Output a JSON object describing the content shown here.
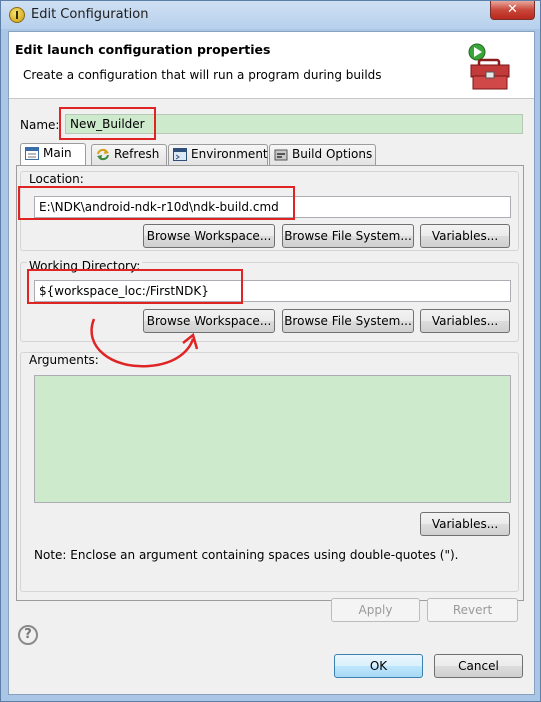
{
  "window": {
    "title": "Edit Configuration",
    "close_glyph": "✕"
  },
  "header": {
    "title": "Edit launch configuration properties",
    "description": "Create a configuration that will run a program during builds"
  },
  "name_field": {
    "label": "Name:",
    "value": "New_Builder"
  },
  "tabs": [
    {
      "label": "Main",
      "icon": "main-tab-icon",
      "active": true
    },
    {
      "label": "Refresh",
      "icon": "refresh-icon",
      "active": false
    },
    {
      "label": "Environment",
      "icon": "environment-icon",
      "active": false
    },
    {
      "label": "Build Options",
      "icon": "build-options-icon",
      "active": false
    }
  ],
  "location": {
    "label": "Location:",
    "value": "E:\\NDK\\android-ndk-r10d\\ndk-build.cmd",
    "buttons": [
      "Browse Workspace...",
      "Browse File System...",
      "Variables..."
    ]
  },
  "working_directory": {
    "label": "Working Directory:",
    "value": "${workspace_loc:/FirstNDK}",
    "buttons": [
      "Browse Workspace...",
      "Browse File System...",
      "Variables..."
    ]
  },
  "arguments": {
    "label": "Arguments:",
    "value": "",
    "variables_button": "Variables...",
    "note": "Note: Enclose an argument containing spaces using double-quotes (\")."
  },
  "actions": {
    "apply": "Apply",
    "revert": "Revert",
    "ok": "OK",
    "cancel": "Cancel",
    "help_glyph": "?"
  },
  "colors": {
    "highlight_red": "#e02323",
    "field_green": "#cdeacd",
    "title_bar": "#b7d0ec"
  }
}
